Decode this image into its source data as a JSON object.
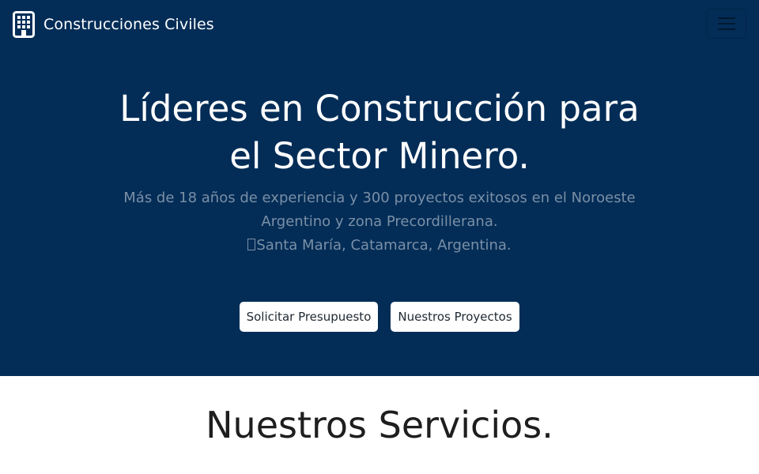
{
  "navbar": {
    "brand_icon": "building-icon",
    "brand_text": "Construcciones Civiles",
    "toggler_icon": "hamburger-menu-icon"
  },
  "hero": {
    "background_color": "#032d57",
    "title_line1": "Líderes en Construcción para",
    "title_line2": "el Sector Minero.",
    "subtitle_line1": "Más de 18 años de experiencia y 300 proyectos exitosos en el Noroeste",
    "subtitle_line2": "Argentino y zona Precordillerana.",
    "location_icon": "missing-glyph-icon",
    "location": "Santa María, Catamarca, Argentina.",
    "buttons": {
      "quote": "Solicitar Presupuesto",
      "projects": "Nuestros Proyectos"
    }
  },
  "services": {
    "title": "Nuestros Servicios."
  }
}
